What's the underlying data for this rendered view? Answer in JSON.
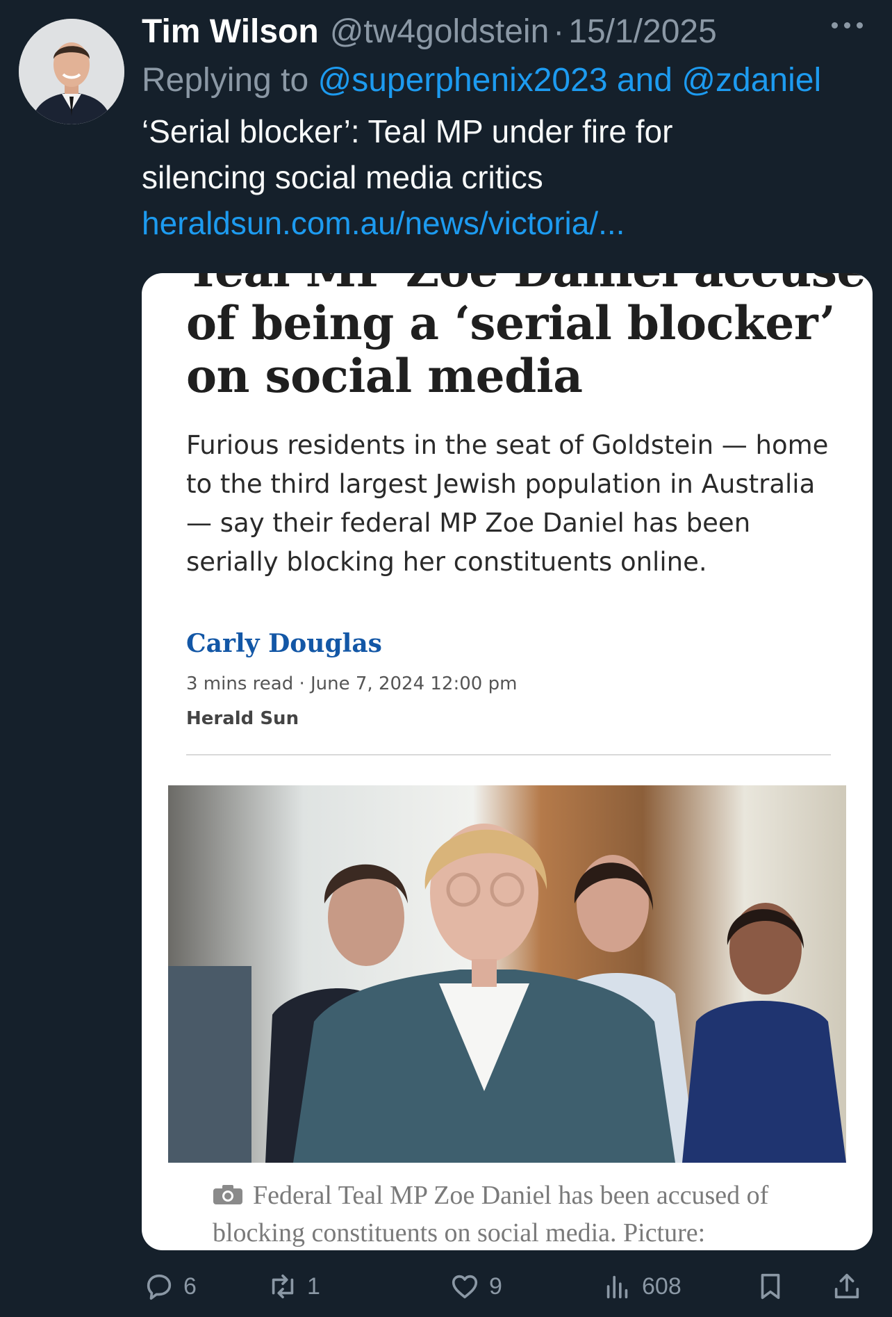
{
  "tweet": {
    "author_name": "Tim Wilson",
    "handle": "@tw4goldstein",
    "separator": "·",
    "date": "15/1/2025",
    "replying_prefix": "Replying to",
    "reply_mention_1": "@superphenix2023",
    "reply_conjunction": "and",
    "reply_mention_2": "@zdaniel",
    "text": "‘Serial blocker’: Teal MP under fire for silencing social media critics",
    "link": "heraldsun.com.au/news/victoria/..."
  },
  "article": {
    "headline_line_top": "Teal MP Zoe Daniel accused",
    "headline": "of being a ‘serial blocker’ on social media",
    "standfirst": "Furious residents in the seat of Goldstein — home to the third largest Jewish population in Australia — say their federal MP Zoe Daniel has been serially blocking her constituents online.",
    "author": "Carly Douglas",
    "meta": "3 mins read · June 7, 2024 12:00 pm",
    "source": "Herald Sun",
    "caption": "Federal Teal MP Zoe Daniel has been accused of blocking constituents on social media. Picture:"
  },
  "actions": {
    "replies": "6",
    "reposts": "1",
    "likes": "9",
    "views": "608"
  },
  "icons": [
    "more-icon",
    "camera-icon",
    "reply-icon",
    "repost-icon",
    "like-icon",
    "views-icon",
    "bookmark-icon",
    "share-icon"
  ],
  "colors": {
    "background": "#15202b",
    "accent": "#1d9bf0",
    "secondary_text": "#8b98a5",
    "author_link": "#1357a6"
  }
}
